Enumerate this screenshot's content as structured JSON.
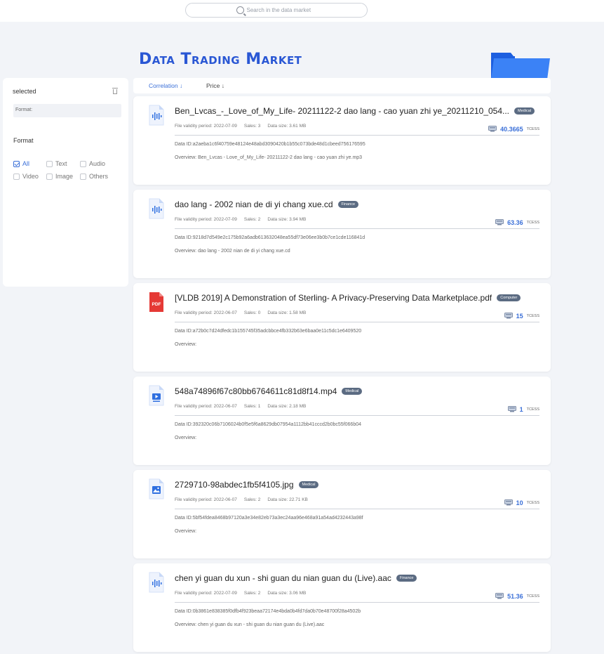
{
  "search": {
    "placeholder": "Search in the data market"
  },
  "title": "Data Trading Market",
  "sidebar": {
    "selected_label": "selected",
    "format_box_label": "Format:",
    "format_heading": "Format",
    "options": [
      {
        "label": "All",
        "checked": true
      },
      {
        "label": "Text",
        "checked": false
      },
      {
        "label": "Audio",
        "checked": false
      },
      {
        "label": "Video",
        "checked": false
      },
      {
        "label": "Image",
        "checked": false
      },
      {
        "label": "Others",
        "checked": false
      }
    ]
  },
  "sort": {
    "correlation": "Correlation",
    "price": "Price"
  },
  "labels": {
    "validity": "File validity period:",
    "sales": "Sales:",
    "size": "Data size:",
    "data_id": "Data ID:",
    "overview": "Overview:",
    "unit": "TCESS"
  },
  "colors": {
    "accent": "#3a6fd8",
    "badge": "#5b6b82",
    "pdf": "#e53935",
    "file_icon": "#2f6fe0"
  },
  "cards": [
    {
      "icon": "audio-file-icon",
      "name": "Ben_Lvcas_-_Love_of_My_Life- 20211122-2 dao lang - cao yuan zhi ye_20211210_054...",
      "tag": "Medical",
      "validity": "2022-07-09",
      "sales": "3",
      "size": "3.61 MB",
      "price": "40.3665",
      "data_id": "a2aeba1c6f40759e48124e48abd3090420b1b55c073bde48d1cbeed756176595",
      "overview": "Ben_Lvcas - Love_of_My_Life- 20211122-2 dao lang - cao yuan zhi ye.mp3"
    },
    {
      "icon": "audio-file-icon",
      "name": "dao lang - 2002 nian de di yi chang xue.cd",
      "tag": "Finance",
      "validity": "2022-07-09",
      "sales": "2",
      "size": "3.94 MB",
      "price": "63.36",
      "data_id": "9218d7d549e2c175b92a6adb613632048ea55df73e06ee3b0b7ce1cde116841d",
      "overview": "dao lang - 2002 nian de di yi chang xue.cd"
    },
    {
      "icon": "pdf-file-icon",
      "name": "[VLDB 2019] A Demonstration of Sterling- A Privacy-Preserving Data Marketplace.pdf",
      "tag": "Computer",
      "validity": "2022-06-07",
      "sales": "0",
      "size": "1.58 MB",
      "price": "15",
      "data_id": "a72b0c7d24dfedc1b155745f35adcbbce4fb332b63e6baa0e11c5dc1e6409520",
      "overview": ""
    },
    {
      "icon": "video-file-icon",
      "name": "548a74896f67c80bb6764611c81d8f14.mp4",
      "tag": "Medical",
      "validity": "2022-06-07",
      "sales": "1",
      "size": "2.18 MB",
      "price": "1",
      "data_id": "392320c06b7106024b0f5e5f6a8629db07954a1112bb41cccd2b0bc55f066b04",
      "overview": ""
    },
    {
      "icon": "image-file-icon",
      "name": "2729710-98abdec1fb5f4105.jpg",
      "tag": "Medical",
      "validity": "2022-06-07",
      "sales": "2",
      "size": "22.71 KB",
      "price": "10",
      "data_id": "5bf54fdea8468b97120a3e34e82eb73a3ec24aa96e468a91a54ad4232443a98f",
      "overview": ""
    },
    {
      "icon": "audio-file-icon",
      "name": "chen yi guan du xun - shi guan du  nian guan du (Live).aac",
      "tag": "Finance",
      "validity": "2022-07-09",
      "sales": "2",
      "size": "3.06 MB",
      "price": "51.36",
      "data_id": "0b3861e838385f0dfb4f923beaa72174e4bda0b4fd7da0b70e48700f28a4502b",
      "overview": "chen yi guan du xun - shi guan du nian guan du (Live).aac"
    }
  ]
}
